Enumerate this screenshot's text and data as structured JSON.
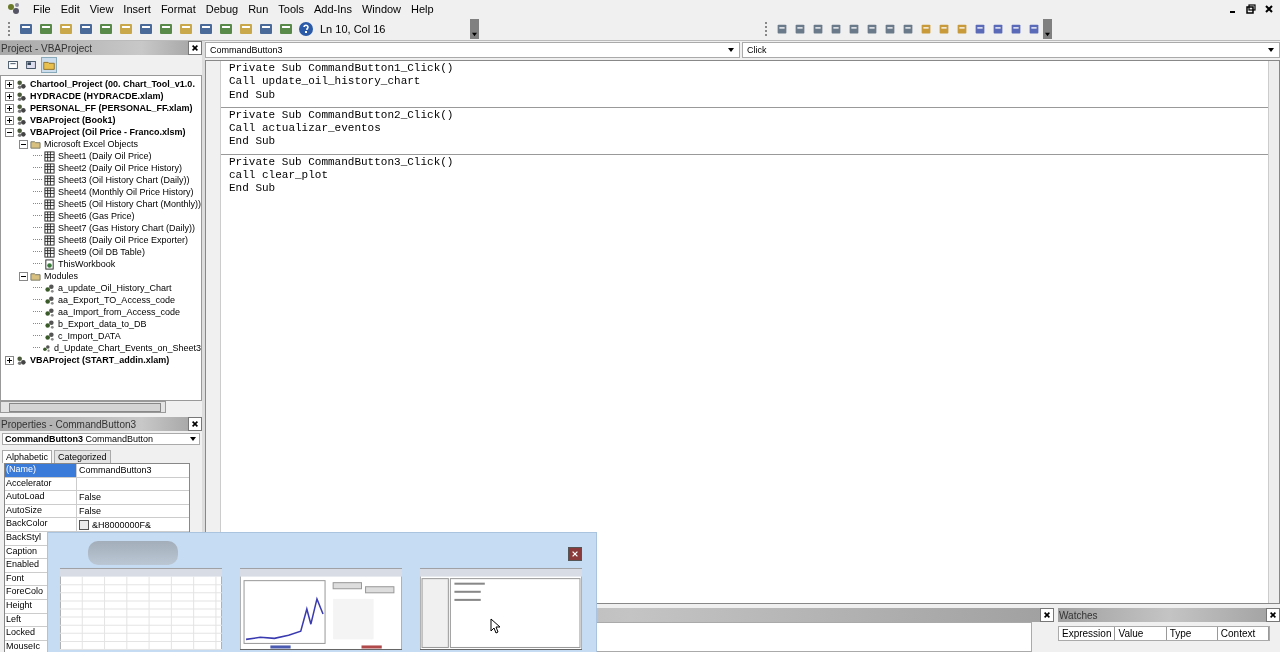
{
  "menu": [
    {
      "label": "File"
    },
    {
      "label": "Edit"
    },
    {
      "label": "View"
    },
    {
      "label": "Insert"
    },
    {
      "label": "Format"
    },
    {
      "label": "Debug"
    },
    {
      "label": "Run"
    },
    {
      "label": "Tools"
    },
    {
      "label": "Add-Ins"
    },
    {
      "label": "Window"
    },
    {
      "label": "Help"
    }
  ],
  "toolbar": {
    "position": "Ln 10, Col 16"
  },
  "project_panel": {
    "title": "Project - VBAProject",
    "tree": [
      {
        "label": "Chartool_Project (00. Chart_Tool_v1.0.",
        "kind": "project",
        "expanded": false
      },
      {
        "label": "HYDRACDE (HYDRACDE.xlam)",
        "kind": "project",
        "expanded": false
      },
      {
        "label": "PERSONAL_FF (PERSONAL_FF.xlam)",
        "kind": "project",
        "expanded": false
      },
      {
        "label": "VBAProject (Book1)",
        "kind": "project",
        "expanded": false
      },
      {
        "label": "VBAProject (Oil Price - Franco.xlsm)",
        "kind": "project",
        "expanded": true,
        "children": [
          {
            "label": "Microsoft Excel Objects",
            "kind": "folder",
            "expanded": true,
            "children": [
              {
                "label": "Sheet1 (Daily Oil Price)",
                "kind": "sheet"
              },
              {
                "label": "Sheet2 (Daily Oil Price History)",
                "kind": "sheet"
              },
              {
                "label": "Sheet3 (Oil History Chart (Daily))",
                "kind": "sheet"
              },
              {
                "label": "Sheet4 (Monthly Oil Price History)",
                "kind": "sheet"
              },
              {
                "label": "Sheet5 (Oil History Chart (Monthly))",
                "kind": "sheet"
              },
              {
                "label": "Sheet6 (Gas Price)",
                "kind": "sheet"
              },
              {
                "label": "Sheet7 (Gas History Chart (Daily))",
                "kind": "sheet"
              },
              {
                "label": "Sheet8 (Daily Oil Price Exporter)",
                "kind": "sheet"
              },
              {
                "label": "Sheet9 (Oil DB Table)",
                "kind": "sheet"
              },
              {
                "label": "ThisWorkbook",
                "kind": "workbook"
              }
            ]
          },
          {
            "label": "Modules",
            "kind": "folder",
            "expanded": true,
            "children": [
              {
                "label": "a_update_Oil_History_Chart",
                "kind": "module"
              },
              {
                "label": "aa_Export_TO_Access_code",
                "kind": "module"
              },
              {
                "label": "aa_Import_from_Access_code",
                "kind": "module"
              },
              {
                "label": "b_Export_data_to_DB",
                "kind": "module"
              },
              {
                "label": "c_Import_DATA",
                "kind": "module"
              },
              {
                "label": "d_Update_Chart_Events_on_Sheet3",
                "kind": "module"
              }
            ]
          }
        ]
      },
      {
        "label": "VBAProject (START_addin.xlam)",
        "kind": "project",
        "expanded": false
      }
    ]
  },
  "properties_panel": {
    "title": "Properties - CommandButton3",
    "object": "**CommandButton3** CommandButton",
    "tabs": [
      {
        "label": "Alphabetic",
        "selected": true
      },
      {
        "label": "Categorized",
        "selected": false
      }
    ],
    "rows": [
      {
        "name": "(Name)",
        "value": "CommandButton3",
        "selected": true
      },
      {
        "name": "Accelerator",
        "value": "",
        "selected": false
      },
      {
        "name": "AutoLoad",
        "value": "False",
        "selected": false
      },
      {
        "name": "AutoSize",
        "value": "False",
        "selected": false
      },
      {
        "name": "BackColor",
        "value": "&H8000000F&",
        "swatch": true,
        "selected": false
      },
      {
        "name": "BackStyl",
        "selected": false
      },
      {
        "name": "Caption",
        "selected": false
      },
      {
        "name": "Enabled",
        "selected": false
      },
      {
        "name": "Font",
        "selected": false
      },
      {
        "name": "ForeColo",
        "selected": false
      },
      {
        "name": "Height",
        "selected": false
      },
      {
        "name": "Left",
        "selected": false
      },
      {
        "name": "Locked",
        "selected": false
      },
      {
        "name": "MouseIc",
        "selected": false
      }
    ]
  },
  "code_window": {
    "object": "CommandButton3",
    "procedure": "Click",
    "procedures": [
      {
        "lines": [
          "Private Sub CommandButton1_Click()",
          "Call update_oil_history_chart",
          "End Sub"
        ]
      },
      {
        "lines": [
          "Private Sub CommandButton2_Click()",
          "Call actualizar_eventos",
          "End Sub"
        ]
      },
      {
        "lines": [
          "Private Sub CommandButton3_Click()",
          "call clear_plot",
          "End Sub"
        ]
      }
    ]
  },
  "watches": {
    "title": "Watches",
    "columns": [
      "Expression",
      "Value",
      "Type",
      "Context"
    ]
  },
  "thumbnail_popup": {
    "thumbnails": [
      {
        "kind": "spreadsheet"
      },
      {
        "kind": "chart"
      },
      {
        "kind": "editor"
      }
    ]
  }
}
